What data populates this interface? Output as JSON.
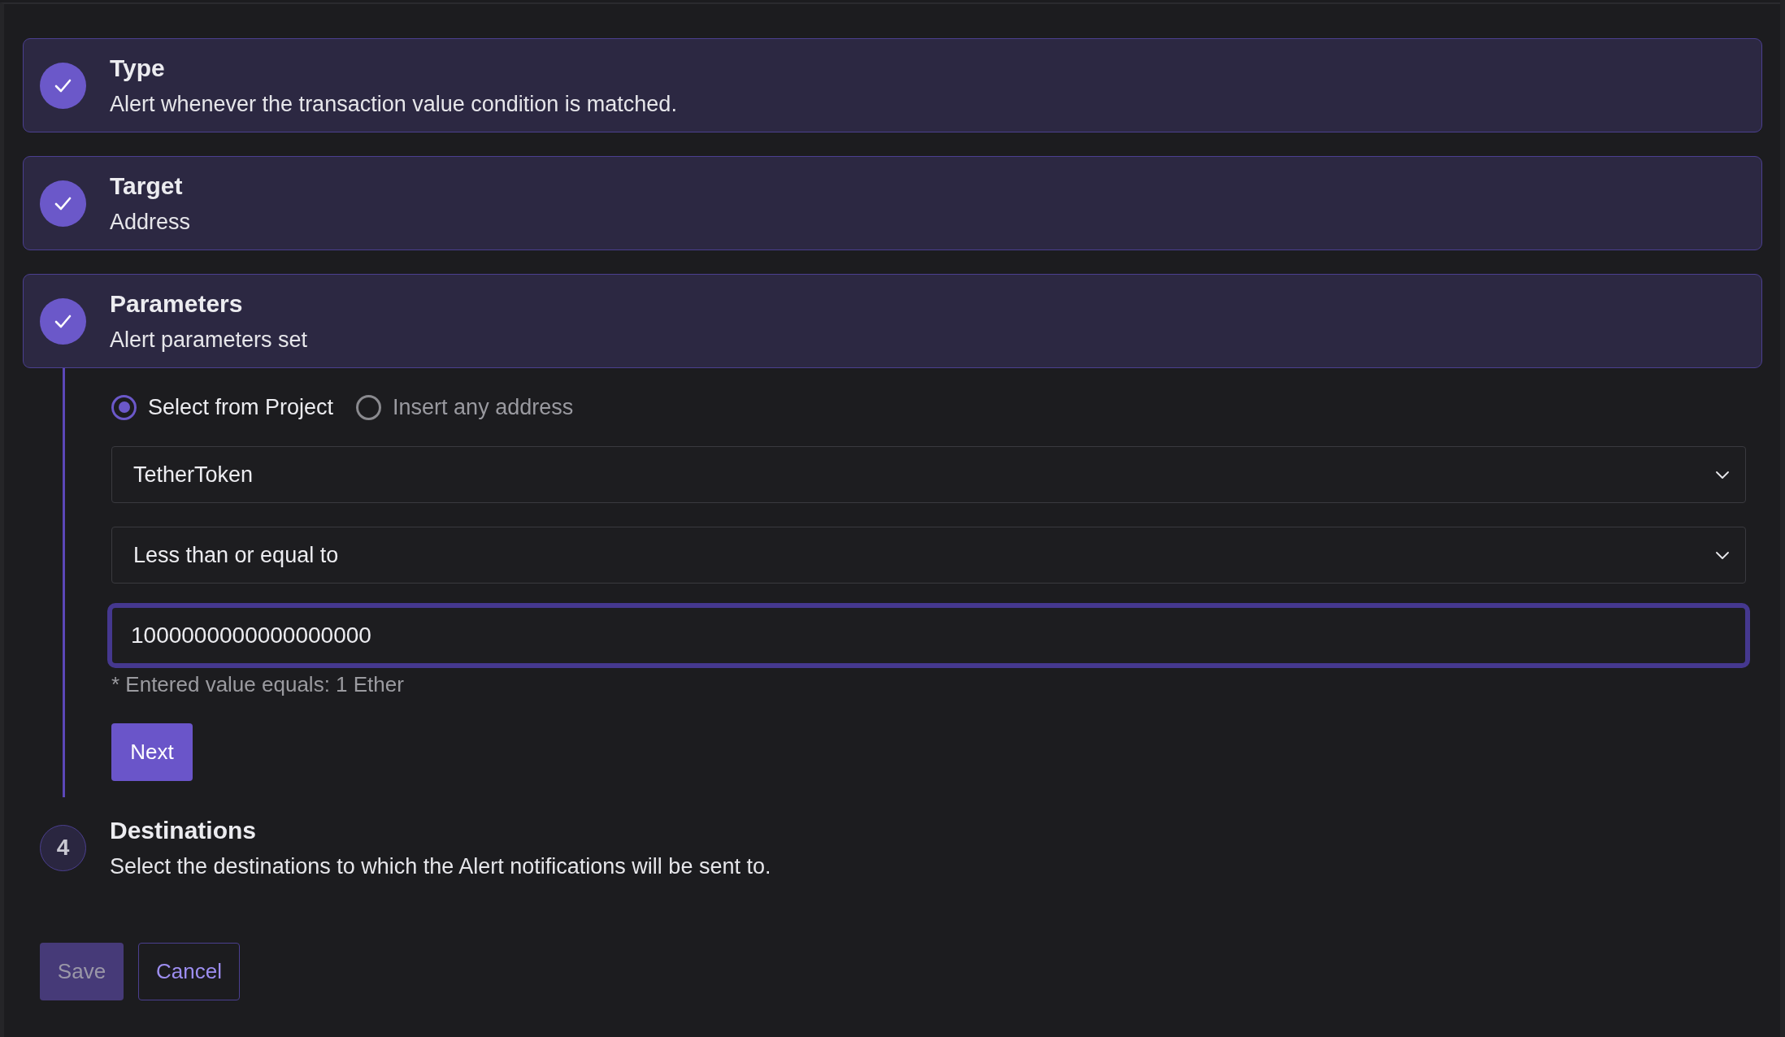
{
  "steps": [
    {
      "title": "Type",
      "description": "Alert whenever the transaction value condition is matched.",
      "completed": true
    },
    {
      "title": "Target",
      "description": "Address",
      "completed": true
    },
    {
      "title": "Parameters",
      "description": "Alert parameters set",
      "completed": true,
      "form": {
        "source_options": [
          {
            "label": "Select from Project",
            "selected": true
          },
          {
            "label": "Insert any address",
            "selected": false
          }
        ],
        "contract_select": {
          "value": "TetherToken"
        },
        "condition_select": {
          "value": "Less than or equal to"
        },
        "value_input": {
          "value": "1000000000000000000",
          "focused": true
        },
        "hint": "* Entered value equals: 1 Ether",
        "next_button": "Next"
      }
    },
    {
      "number": "4",
      "title": "Destinations",
      "description": "Select the destinations to which the Alert notifications will be sent to.",
      "completed": false
    }
  ],
  "actions": [
    {
      "label": "Save",
      "kind": "primary",
      "disabled": true
    },
    {
      "label": "Cancel",
      "kind": "secondary",
      "disabled": false
    }
  ]
}
